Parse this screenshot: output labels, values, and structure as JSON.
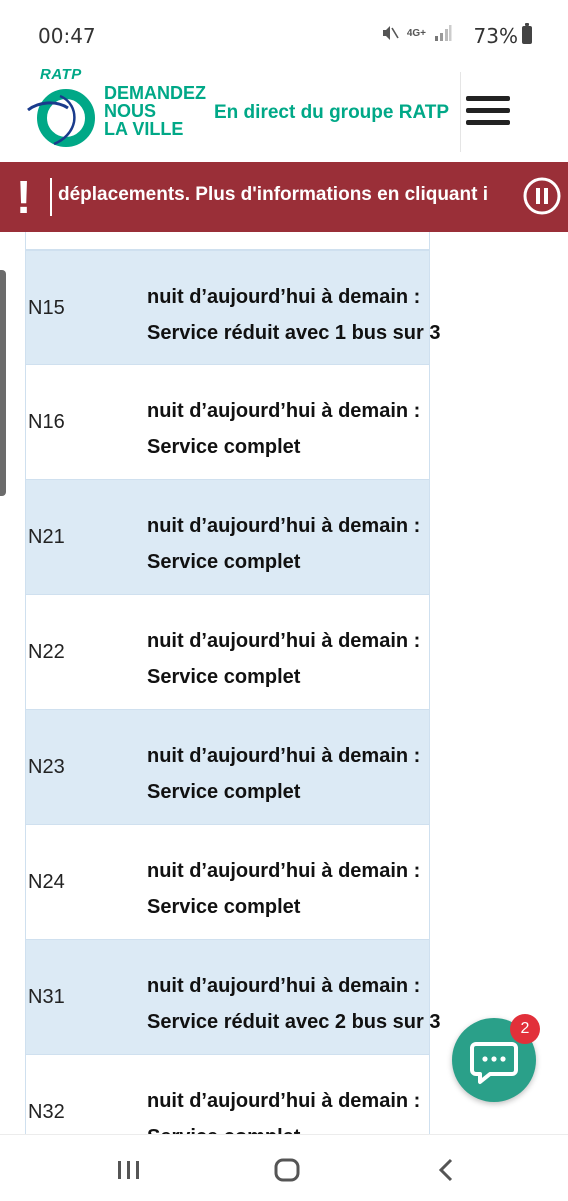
{
  "status_bar": {
    "time": "00:47",
    "network": "4G+",
    "battery": "73%"
  },
  "header": {
    "logo_brand": "RATP",
    "logo_tag_lines": [
      "DEMANDEZ",
      "NOUS",
      "LA VILLE"
    ],
    "live_label": "En direct du groupe RATP"
  },
  "alert": {
    "mark": "!",
    "text": "déplacements. Plus d'informations en cliquant ici"
  },
  "rows": [
    {
      "line": "N15",
      "info1": "nuit d’aujourd’hui à demain :",
      "info2": "Service réduit avec 1 bus sur 3",
      "alt": true
    },
    {
      "line": "N16",
      "info1": "nuit d’aujourd’hui à demain :",
      "info2": "Service complet",
      "alt": false
    },
    {
      "line": "N21",
      "info1": "nuit d’aujourd’hui à demain :",
      "info2": "Service complet",
      "alt": true
    },
    {
      "line": "N22",
      "info1": "nuit d’aujourd’hui à demain :",
      "info2": "Service complet",
      "alt": false
    },
    {
      "line": "N23",
      "info1": "nuit d’aujourd’hui à demain :",
      "info2": "Service complet",
      "alt": true
    },
    {
      "line": "N24",
      "info1": "nuit d’aujourd’hui à demain :",
      "info2": "Service complet",
      "alt": false
    },
    {
      "line": "N31",
      "info1": "nuit d’aujourd’hui à demain :",
      "info2": "Service réduit avec 2 bus sur 3",
      "alt": true
    },
    {
      "line": "N32",
      "info1": "nuit d’aujourd’hui à demain :",
      "info2": "Service complet",
      "alt": false
    }
  ],
  "chat": {
    "badge": "2"
  },
  "colors": {
    "brand_green": "#00a887",
    "alert_red": "#9a2f38",
    "row_alt": "#dceaf5",
    "chat_green": "#2aa089",
    "badge_red": "#e2303a"
  }
}
